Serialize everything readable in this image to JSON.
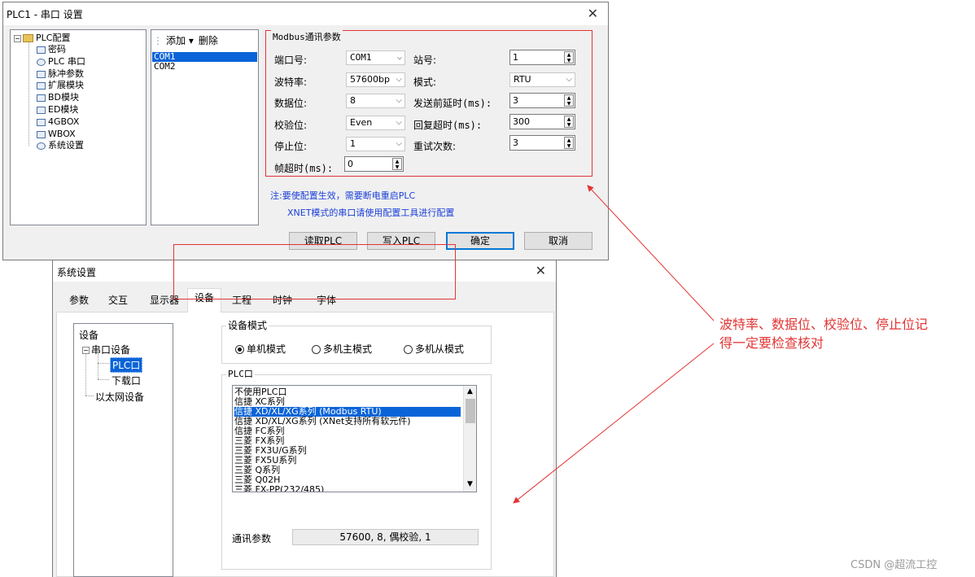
{
  "plc_dialog": {
    "title": "PLC1 - 串口 设置",
    "close": "✕",
    "tree": {
      "root": "PLC配置",
      "expander": "−",
      "items": [
        "密码",
        "PLC 串口",
        "脉冲参数",
        "扩展模块",
        "BD模块",
        "ED模块",
        "4GBOX",
        "WBOX",
        "系统设置"
      ]
    },
    "com_toolbar": {
      "add": "添加 ▾",
      "delete": "删除"
    },
    "com_items": [
      "COM1",
      "COM2"
    ],
    "modbus": {
      "legend": "Modbus通讯参数",
      "port_label": "端口号:",
      "port_value": "COM1",
      "station_label": "站号:",
      "station_value": "1",
      "baud_label": "波特率:",
      "baud_value": "57600bp",
      "mode_label": "模式:",
      "mode_value": "RTU",
      "databits_label": "数据位:",
      "databits_value": "8",
      "send_delay_label": "发送前延时(ms):",
      "send_delay_value": "3",
      "parity_label": "校验位:",
      "parity_value": "Even",
      "reply_timeout_label": "回复超时(ms):",
      "reply_timeout_value": "300",
      "stopbits_label": "停止位:",
      "stopbits_value": "1",
      "retry_label": "重试次数:",
      "retry_value": "3",
      "frame_timeout_label": "帧超时(ms):",
      "frame_timeout_value": "0"
    },
    "notes": [
      "注:要使配置生效，需要断电重启PLC",
      "XNET模式的串口请使用配置工具进行配置"
    ],
    "buttons": {
      "read": "读取PLC",
      "write": "写入PLC",
      "ok": "确定",
      "cancel": "取消"
    }
  },
  "sys_dialog": {
    "title": "系统设置",
    "close": "✕",
    "tabs": [
      "参数",
      "交互",
      "显示器",
      "设备",
      "工程",
      "时钟",
      "字体"
    ],
    "active_tab": "设备",
    "device_tree": {
      "root": "设备",
      "serial": "串口设备",
      "plc_port": "PLC口",
      "download_port": "下载口",
      "ethernet": "以太网设备",
      "expander": "−"
    },
    "device_mode": {
      "legend": "设备模式",
      "options": [
        "单机模式",
        "多机主模式",
        "多机从模式"
      ],
      "selected": "单机模式"
    },
    "plc_port": {
      "legend": "PLC口",
      "items": [
        "不使用PLC口",
        "信捷 XC系列",
        "信捷 XD/XL/XG系列 (Modbus RTU)",
        "信捷 XD/XL/XG系列 (XNet支持所有软元件)",
        "信捷 FC系列",
        "三菱 FX系列",
        "三菱 FX3U/G系列",
        "三菱 FX5U系列",
        "三菱 Q系列",
        "三菱 Q02H",
        "三菱 FX-PP(232/485)"
      ],
      "selected_index": 2,
      "scroll_up": "▲",
      "scroll_down": "▼"
    },
    "comm_params": {
      "label": "通讯参数",
      "value": "57600, 8, 偶校验, 1"
    }
  },
  "annotation": {
    "text_line1": "波特率、数据位、校验位、停止位记",
    "text_line2": "得一定要检查核对",
    "color": "#e23434"
  },
  "watermark": "CSDN @超流工控"
}
